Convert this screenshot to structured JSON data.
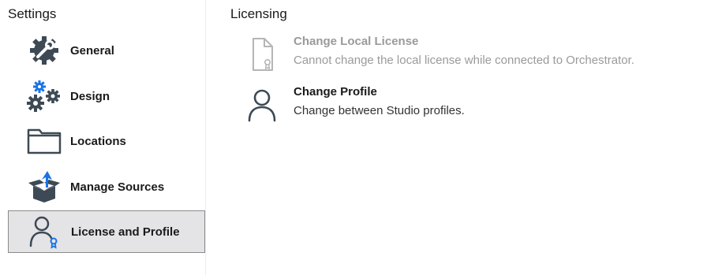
{
  "sidebar": {
    "title": "Settings",
    "items": [
      {
        "label": "General",
        "icon": "gear-wrench-icon"
      },
      {
        "label": "Design",
        "icon": "gears-icon"
      },
      {
        "label": "Locations",
        "icon": "folder-icon"
      },
      {
        "label": "Manage Sources",
        "icon": "package-upload-icon"
      },
      {
        "label": "License and Profile",
        "icon": "user-license-icon",
        "selected": true
      }
    ]
  },
  "main": {
    "title": "Licensing",
    "options": [
      {
        "title": "Change Local License",
        "description": "Cannot change the local license while connected to Orchestrator.",
        "icon": "license-file-icon",
        "disabled": true
      },
      {
        "title": "Change Profile",
        "description": "Change between Studio profiles.",
        "icon": "user-icon",
        "disabled": false
      }
    ]
  },
  "colors": {
    "icon_dark": "#3d4a55",
    "accent_blue": "#1a73e8",
    "selected_bg": "#e4e4e6",
    "disabled_text": "#9a9a9a"
  }
}
